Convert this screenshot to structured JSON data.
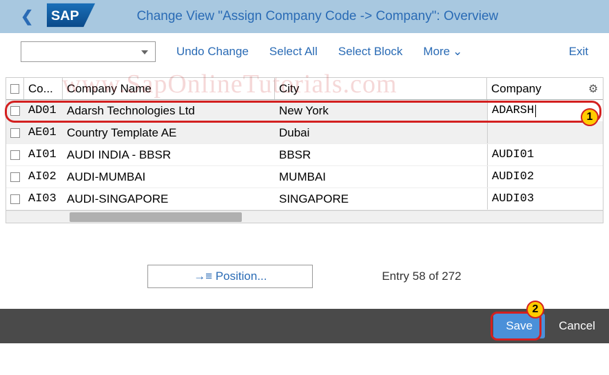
{
  "header": {
    "title": "Change View \"Assign Company Code -> Company\": Overview"
  },
  "toolbar": {
    "undo": "Undo Change",
    "select_all": "Select All",
    "select_block": "Select Block",
    "more": "More",
    "exit": "Exit"
  },
  "watermark": "www.SapOnlineTutorials.com",
  "table": {
    "headers": {
      "code": "Co...",
      "name": "Company Name",
      "city": "City",
      "company": "Company"
    },
    "rows": [
      {
        "code": "AD01",
        "name": "Adarsh Technologies Ltd",
        "city": "New York",
        "company": "ADARSH",
        "editing": true
      },
      {
        "code": "AE01",
        "name": "Country Template AE",
        "city": "Dubai",
        "company": ""
      },
      {
        "code": "AI01",
        "name": "AUDI INDIA - BBSR",
        "city": "BBSR",
        "company": "AUDI01"
      },
      {
        "code": "AI02",
        "name": "AUDI-MUMBAI",
        "city": "MUMBAI",
        "company": "AUDI02"
      },
      {
        "code": "AI03",
        "name": "AUDI-SINGAPORE",
        "city": "SINGAPORE",
        "company": "AUDI03"
      }
    ]
  },
  "position": {
    "button": "Position...",
    "entry_text": "Entry 58 of 272"
  },
  "footer": {
    "save": "Save",
    "cancel": "Cancel"
  },
  "callouts": {
    "c1": "1",
    "c2": "2"
  }
}
